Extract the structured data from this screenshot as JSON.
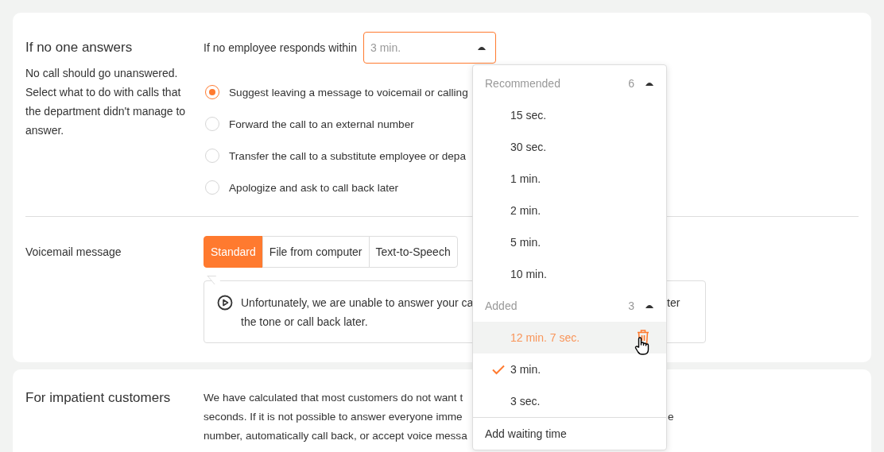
{
  "unanswered": {
    "title": "If no one answers",
    "description": "No call should go unanswered. Select what to do with calls that the department didn't manage to answer.",
    "timeout_label": "If no employee responds within",
    "timeout_select": {
      "value": "3 min.",
      "expanded": true
    },
    "options": [
      {
        "label": "Suggest leaving a message to voicemail or calling",
        "selected": true
      },
      {
        "label": "Forward the call to an external number",
        "selected": false
      },
      {
        "label": "Transfer the call to a substitute employee or depa",
        "selected": false
      },
      {
        "label": "Apologize and ask to call back later",
        "selected": false
      }
    ]
  },
  "voicemail": {
    "label": "Voicemail message",
    "tabs": [
      {
        "label": "Standard",
        "selected": true
      },
      {
        "label": "File from computer",
        "selected": false
      },
      {
        "label": "Text-to-Speech",
        "selected": false
      }
    ],
    "message_lines": [
      "Unfortunately, we are unable to answer your ca",
      "the tone or call back later."
    ],
    "message_fragment": "ter"
  },
  "impatient": {
    "title": "For impatient customers",
    "lines": [
      "We have calculated that most customers do not want t",
      "seconds. If it is not possible to answer everyone imme",
      "number, automatically call back, or accept voice messa"
    ],
    "fragment": "e"
  },
  "dropdown": {
    "groups": [
      {
        "title": "Recommended",
        "count": "6",
        "expanded": true,
        "items": [
          {
            "label": "15 sec.",
            "selected": false,
            "highlighted": false
          },
          {
            "label": "30 sec.",
            "selected": false,
            "highlighted": false
          },
          {
            "label": "1 min.",
            "selected": false,
            "highlighted": false
          },
          {
            "label": "2 min.",
            "selected": false,
            "highlighted": false
          },
          {
            "label": "5 min.",
            "selected": false,
            "highlighted": false
          },
          {
            "label": "10 min.",
            "selected": false,
            "highlighted": false
          }
        ]
      },
      {
        "title": "Added",
        "count": "3",
        "expanded": true,
        "items": [
          {
            "label": "12 min. 7 sec.",
            "selected": false,
            "highlighted": true
          },
          {
            "label": "3 min.",
            "selected": true,
            "highlighted": false
          },
          {
            "label": "3 sec.",
            "selected": false,
            "highlighted": false
          }
        ]
      }
    ],
    "footer": "Add waiting time"
  }
}
